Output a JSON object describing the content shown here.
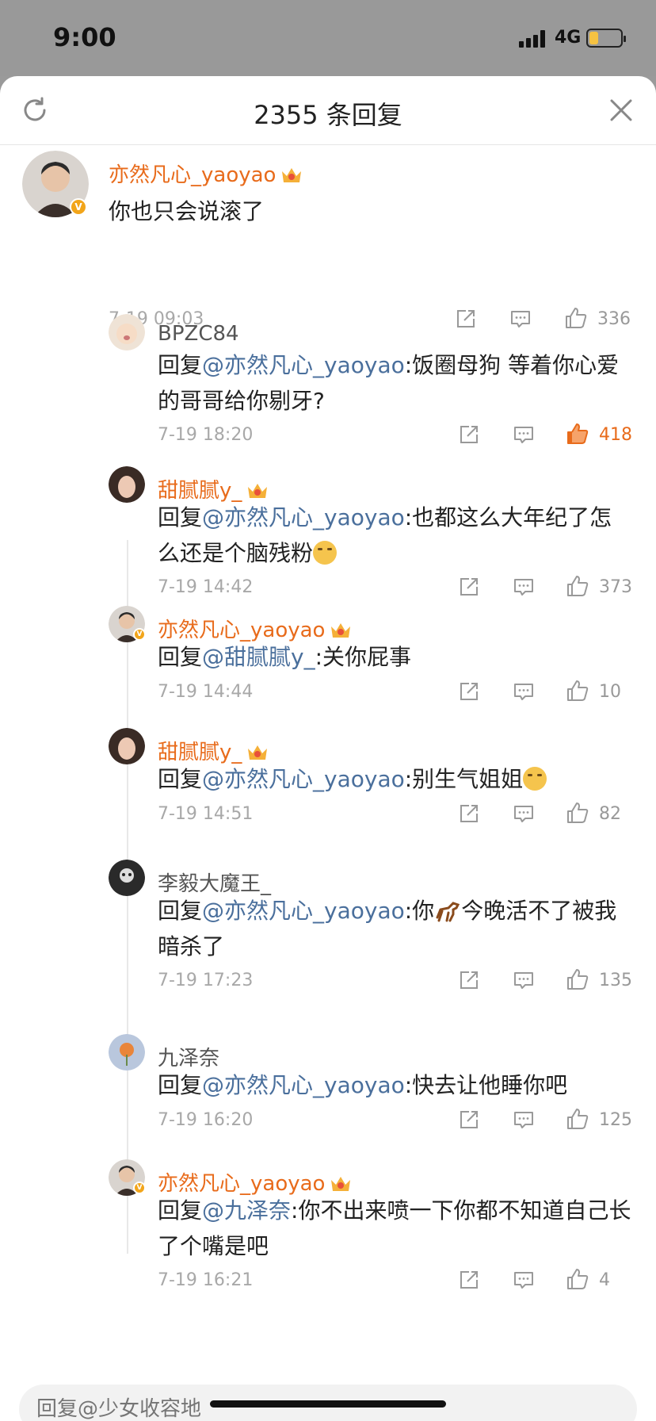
{
  "status_bar": {
    "time": "9:00",
    "network": "4G",
    "battery_level": 0.3
  },
  "header": {
    "title": "2355 条回复"
  },
  "colors": {
    "username_orange": "#e86b1b",
    "mention_blue": "#4a6f9c",
    "liked_orange": "#e86b1b",
    "meta_grey": "#a8a8a8"
  },
  "main_comment": {
    "user": "亦然凡心_yaoyao",
    "text": "你也只会说滚了",
    "time": "7-19 09:03",
    "likes": "336"
  },
  "replies": [
    {
      "user": "BPZC84",
      "prefix": "回复",
      "mention": "@亦然凡心_yaoyao",
      "text": ":饭圈母狗 等着你心爱的哥哥给你剔牙?",
      "time": "7-19 18:20",
      "likes": "418"
    },
    {
      "user": "甜腻腻y_",
      "prefix": "回复",
      "mention": "@亦然凡心_yaoyao",
      "text": ":也都这么大年纪了怎么还是个脑残粉",
      "time": "7-19 14:42",
      "likes": "373"
    },
    {
      "user": "亦然凡心_yaoyao",
      "prefix": "回复",
      "mention": "@甜腻腻y_",
      "text": ":关你屁事",
      "time": "7-19 14:44",
      "likes": "10"
    },
    {
      "user": "甜腻腻y_",
      "prefix": "回复",
      "mention": "@亦然凡心_yaoyao",
      "text": ":别生气姐姐",
      "time": "7-19 14:51",
      "likes": "82"
    },
    {
      "user": "李毅大魔王_",
      "prefix": "回复",
      "mention": "@亦然凡心_yaoyao",
      "text_a": ":你",
      "text_b": "今晚活不了被我暗杀了",
      "time": "7-19 17:23",
      "likes": "135"
    },
    {
      "user": "九泽奈",
      "prefix": "回复",
      "mention": "@亦然凡心_yaoyao",
      "text": ":快去让他睡你吧",
      "time": "7-19 16:20",
      "likes": "125"
    },
    {
      "user": "亦然凡心_yaoyao",
      "prefix": "回复",
      "mention": "@九泽奈",
      "text": ":你不出来喷一下你都不知道自己长了个嘴是吧",
      "time": "7-19 16:21",
      "likes": "4"
    }
  ],
  "input": {
    "placeholder": "回复@少女收容地"
  }
}
